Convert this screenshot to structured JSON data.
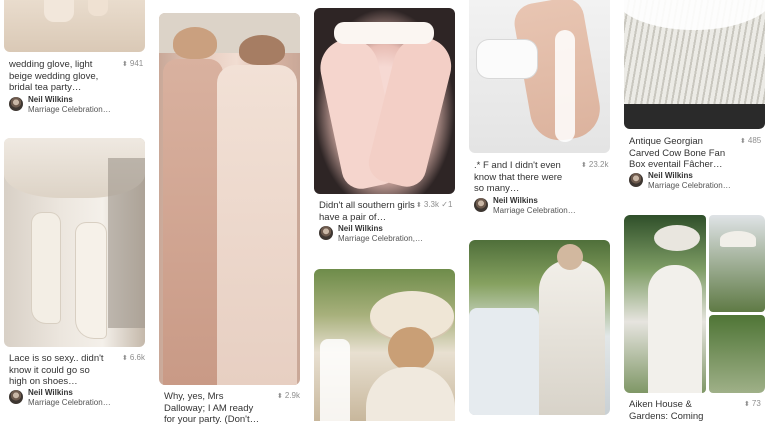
{
  "pins": [
    {
      "id": "wedding-glove",
      "description": "wedding glove, light beige wedding glove, bridal tea party…",
      "saves": "941",
      "user": "Neil Wilkins",
      "board": "Marriage Celebration…"
    },
    {
      "id": "lace-boots",
      "description": "Lace is so sexy.. didn't know it could go so high on shoes…",
      "saves": "6.6k",
      "user": "Neil Wilkins",
      "board": "Marriage Celebration…"
    },
    {
      "id": "dalloway-dresses",
      "description": "Why, yes, Mrs Dalloway; I AM ready for your party. (Don't…",
      "saves": "2.9k"
    },
    {
      "id": "southern-gloves",
      "description": "Didn't all southern girls have a pair of…",
      "saves": "3.3k",
      "likes": "1",
      "user": "Neil Wilkins",
      "board": "Marriage Celebration,…"
    },
    {
      "id": "lace-glove-hand",
      "description": ".* F and I didn't even know that there were so many…",
      "saves": "23.2k",
      "user": "Neil Wilkins",
      "board": "Marriage Celebration…"
    },
    {
      "id": "georgian-fan",
      "description": "Antique Georgian Carved Cow Bone Fan Box eventail Fâcher…",
      "saves": "485",
      "user": "Neil Wilkins",
      "board": "Marriage Celebration…"
    },
    {
      "id": "aiken-house",
      "description": "Aiken House & Gardens: Coming",
      "saves": "73"
    }
  ],
  "icons": {
    "save": "pushpin-icon",
    "like": "checkmark-icon"
  }
}
